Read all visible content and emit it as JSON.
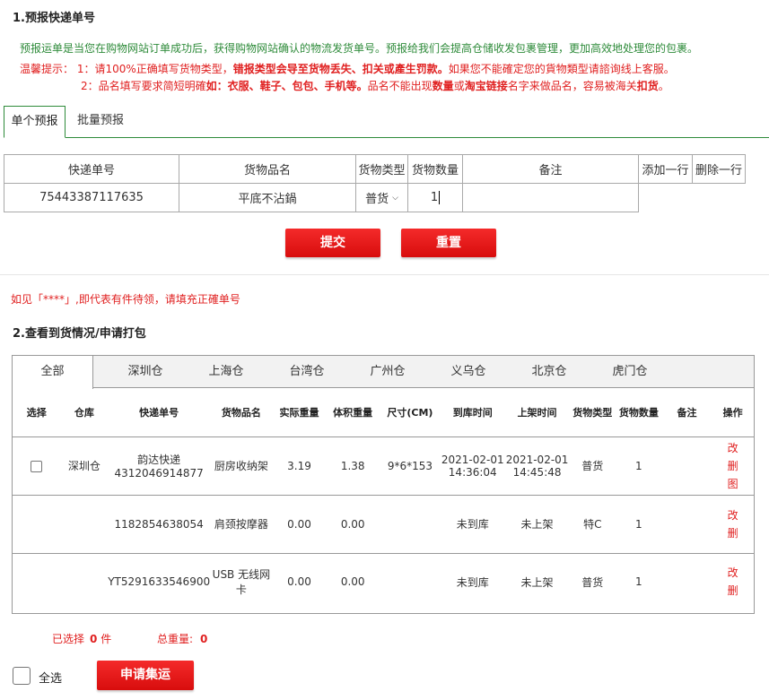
{
  "section1": {
    "title": "1.预报快递单号",
    "intro": "预报运单是当您在购物网站订单成功后，获得购物网站确认的物流发货单号。预报给我们会提高仓储收发包裹管理，更加高效地处理您的包裹。",
    "tip_prefix": "温馨提示：  1：请100%正确填写货物类型，",
    "tip_b1": "错报类型会导至货物丢失、扣关或產生罚款。",
    "tip_rest1": "如果您不能確定您的貨物類型请諮询线上客服。",
    "tip2_prefix": "2：品名填写要求简短明確",
    "tip2_b1": "如：衣服、鞋子、包包、手机等。",
    "tip2_mid": "品名不能出现",
    "tip2_b2": "数量",
    "tip2_mid2": "或",
    "tip2_b3": "淘宝链接",
    "tip2_mid3": "名字来做品名，容易被海关",
    "tip2_b4": "扣货",
    "tip2_end": "。"
  },
  "tabs": {
    "single": "单个预报",
    "batch": "批量预报"
  },
  "form": {
    "headers": [
      "快递单号",
      "货物品名",
      "货物类型",
      "货物数量",
      "备注"
    ],
    "add_row": "添加一行",
    "delete_row": "删除一行",
    "row": {
      "tracking": "75443387117635",
      "item": "平底不沾鍋",
      "type": "普货",
      "qty": "1",
      "remark": ""
    }
  },
  "buttons": {
    "submit": "提交",
    "reset": "重置",
    "apply": "申请集运"
  },
  "note": "如见「****」,即代表有件待领，请填充正確单号",
  "section2": {
    "title": "2.查看到货情况/申请打包"
  },
  "warehouse_tabs": [
    "全部",
    "深圳仓",
    "上海仓",
    "台湾仓",
    "广州仓",
    "义乌仓",
    "北京仓",
    "虎门仓"
  ],
  "grid": {
    "headers": [
      "选择",
      "仓库",
      "快递单号",
      "货物品名",
      "实际重量",
      "体积重量",
      "尺寸(CM)",
      "到库时间",
      "上架时间",
      "货物类型",
      "货物数量",
      "备注",
      "操作"
    ],
    "rows": [
      {
        "warehouse": "深圳仓",
        "courier": "韵达快递",
        "tracking": "4312046914877",
        "item": "厨房收纳架",
        "weight": "3.19",
        "vol_weight": "1.38",
        "size": "9*6*153",
        "arrive": "2021-02-01 14:36:04",
        "shelf": "2021-02-01 14:45:48",
        "type": "普货",
        "qty": "1",
        "remark": "",
        "ops": [
          "改",
          "删",
          "图"
        ]
      },
      {
        "warehouse": "",
        "courier": "",
        "tracking": "1182854638054",
        "item": "肩颈按摩器",
        "weight": "0.00",
        "vol_weight": "0.00",
        "size": "",
        "arrive": "未到库",
        "shelf": "未上架",
        "type": "特C",
        "qty": "1",
        "remark": "",
        "ops": [
          "改",
          "删"
        ]
      },
      {
        "warehouse": "",
        "courier": "",
        "tracking": "YT5291633546900",
        "item": "USB 无线网卡",
        "weight": "0.00",
        "vol_weight": "0.00",
        "size": "",
        "arrive": "未到库",
        "shelf": "未上架",
        "type": "普货",
        "qty": "1",
        "remark": "",
        "ops": [
          "改",
          "删"
        ]
      }
    ]
  },
  "summary": {
    "selected_label": "已选择",
    "selected_count": "0",
    "selected_unit": "件",
    "weight_label": "总重量:",
    "weight_value": "0"
  },
  "select_all": "全选"
}
